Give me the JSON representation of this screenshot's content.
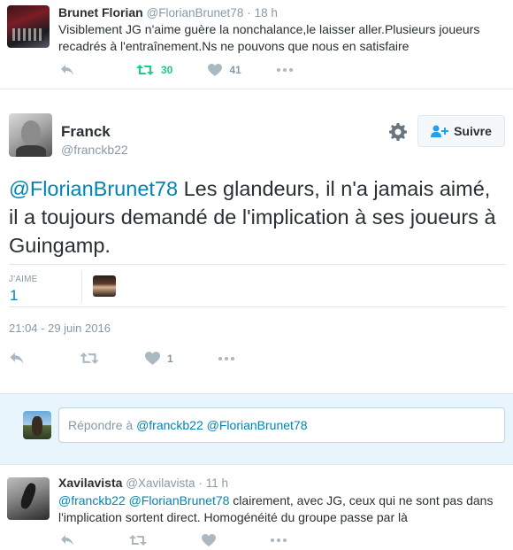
{
  "tweet_prev": {
    "name": "Brunet Florian",
    "handle": "@FlorianBrunet78",
    "time": "18 h",
    "text": "Visiblement JG n'aime guère la nonchalance,le laisser aller.Plusieurs joueurs recadrés à l'entraînement.Ns ne pouvons que nous en satisfaire",
    "retweets": "30",
    "likes": "41",
    "icons": [
      "reply-icon",
      "retweet-icon",
      "heart-icon",
      "more-icon"
    ]
  },
  "main_tweet": {
    "name": "Franck",
    "handle": "@franckb22",
    "follow_label": "Suivre",
    "mention": "@FlorianBrunet78",
    "text": " Les glandeurs, il n'a jamais aimé, il a toujours demandé de l'implication à ses joueurs à Guingamp.",
    "likes_label": "J'AIME",
    "likes_count": "1",
    "timestamp": "21:04 - 29 juin 2016",
    "action_likes": "1",
    "icons": [
      "gear-icon",
      "follow-user-icon",
      "reply-icon",
      "retweet-icon",
      "heart-icon",
      "more-icon"
    ]
  },
  "reply_box": {
    "prefix": "Répondre à ",
    "mention1": "@franckb22",
    "mention2": "@FlorianBrunet78"
  },
  "tweet_next": {
    "name": "Xavilavista",
    "handle": "@Xavilavista",
    "time": "11 h",
    "mention1": "@franckb22",
    "mention2": "@FlorianBrunet78",
    "text": " clairement, avec JG, ceux qui ne sont pas dans l'implication sortent direct. Homogénéité du groupe  passe par là"
  },
  "colors": {
    "link": "#0084b4",
    "retweet_active": "#19cf86",
    "muted": "#8899a6",
    "reply_bg": "#e8f5fd"
  }
}
